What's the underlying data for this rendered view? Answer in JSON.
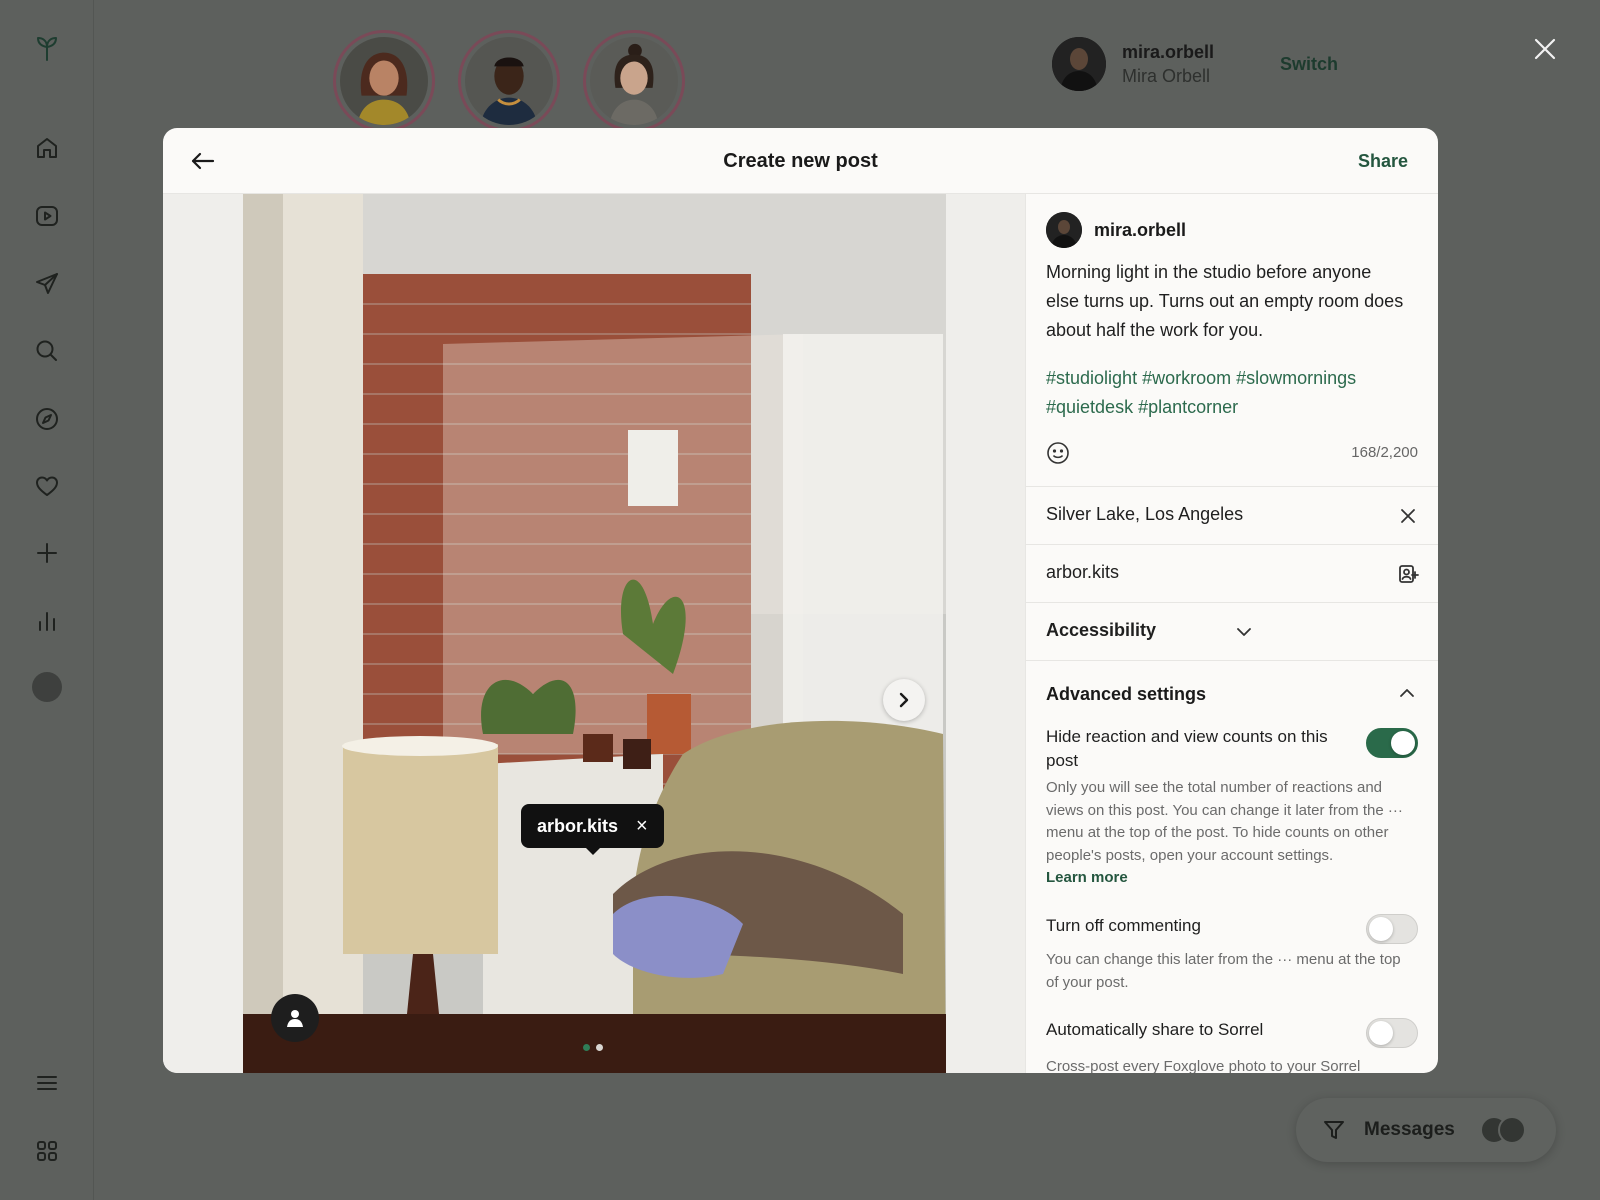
{
  "stories": [
    {
      "name": "story-1"
    },
    {
      "name": "story-2"
    },
    {
      "name": "story-3"
    }
  ],
  "account": {
    "username": "mira.orbell",
    "display_name": "Mira Orbell",
    "switch_label": "Switch"
  },
  "rail": {
    "icons": [
      "logo-sprout-icon",
      "home-icon",
      "reels-icon",
      "send-icon",
      "search-icon",
      "explore-icon",
      "heart-icon",
      "create-icon",
      "insights-icon",
      "profile-avatar",
      "menu-icon",
      "apps-grid-icon"
    ]
  },
  "modal": {
    "title": "Create new post",
    "share_label": "Share",
    "author": "mira.orbell",
    "caption": "Morning light in the studio before anyone else turns up. Turns out an empty room does about half the work for you.",
    "hashtags": "#studiolight #workroom #slowmornings #quietdesk #plantcorner",
    "char_count": "168/2,200",
    "tag_chip": "arbor.kits",
    "tag_chip_close": "×",
    "carousel": {
      "count": 2,
      "active": 0
    },
    "location": "Silver Lake, Los Angeles",
    "tagged_user": "arbor.kits",
    "accessibility_label": "Accessibility",
    "advanced_label": "Advanced settings",
    "settings": {
      "hide_counts_label": "Hide reaction and view counts on this post",
      "hide_counts_on": true,
      "hide_counts_desc": "Only you will see the total number of reactions and views on this post. You can change it later from the ··· menu at the top of the post. To hide counts on other people's posts, open your account settings.",
      "learn_more": "Learn more",
      "comments_label": "Turn off commenting",
      "comments_on": false,
      "comments_desc": "You can change this later from the ··· menu at the top of your post.",
      "autoshare_label": "Automatically share to Sorrel",
      "autoshare_on": false,
      "autoshare_desc": "Cross-post every Foxglove photo to your Sorrel"
    }
  },
  "messages": {
    "label": "Messages"
  },
  "colors": {
    "accent": "#2a6a4a",
    "overlay": "#5d605d",
    "tag_chip": "#111111"
  }
}
